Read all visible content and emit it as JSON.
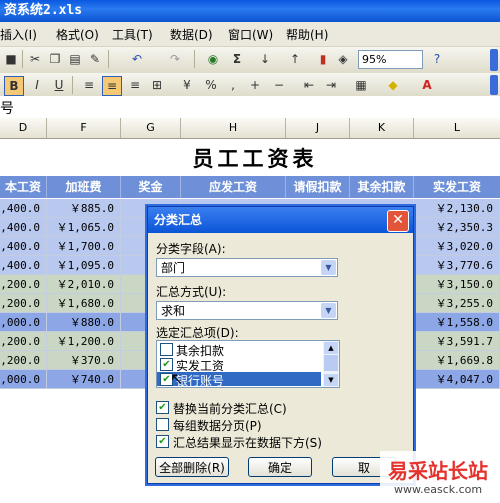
{
  "window": {
    "title": "资系统2.xls"
  },
  "menu": [
    "插入(I)",
    "格式(O)",
    "工具(T)",
    "数据(D)",
    "窗口(W)",
    "帮助(H)"
  ],
  "toolbar": {
    "zoom": "95%"
  },
  "formula_bar": {
    "text": "号"
  },
  "columns": [
    "D",
    "F",
    "G",
    "H",
    "J",
    "K",
    "L"
  ],
  "sheet": {
    "title": "员工工资表",
    "headers": [
      "本工资",
      "加班费",
      "奖金",
      "应发工资",
      "请假扣款",
      "其余扣款",
      "实发工资"
    ],
    "rows": [
      {
        "d": ",400.0",
        "f": "￥885.0",
        "g": "",
        "l": "￥2,130.0",
        "color": "#b8c8ee"
      },
      {
        "d": ",400.0",
        "f": "￥1,065.0",
        "g": "",
        "l": "￥2,350.3",
        "color": "#b8c8ee"
      },
      {
        "d": ",400.0",
        "f": "￥1,700.0",
        "g": "",
        "l": "￥3,020.0",
        "color": "#b8c8ee"
      },
      {
        "d": ",400.0",
        "f": "￥1,095.0",
        "g": "￥1,",
        "l": "￥3,770.6",
        "color": "#b8c8ee"
      },
      {
        "d": ",200.0",
        "f": "￥2,010.0",
        "g": "",
        "l": "￥3,150.0",
        "color": "#c9d7c4"
      },
      {
        "d": ",200.0",
        "f": "￥1,680.0",
        "g": "￥5",
        "l": "￥3,255.0",
        "color": "#c9d7c4"
      },
      {
        "d": ",000.0",
        "f": "￥880.0",
        "g": "￥1",
        "l": "￥1,558.0",
        "color": "#8ca6e6"
      },
      {
        "d": ",200.0",
        "f": "￥1,200.0",
        "g": "￥1",
        "l": "￥3,591.7",
        "color": "#c9d7c4"
      },
      {
        "d": ",200.0",
        "f": "￥370.0",
        "g": "￥1",
        "l": "￥1,669.8",
        "color": "#c9d7c4"
      },
      {
        "d": ",000.0",
        "f": "￥740.0",
        "g": "￥1,",
        "l": "￥4,047.0",
        "color": "#8ca6e6"
      }
    ]
  },
  "dialog": {
    "title": "分类汇总",
    "field_label": "分类字段(A):",
    "field_value": "部门",
    "method_label": "汇总方式(U):",
    "method_value": "求和",
    "items_label": "选定汇总项(D):",
    "items": [
      {
        "label": "其余扣款",
        "checked": false
      },
      {
        "label": "实发工资",
        "checked": true
      },
      {
        "label": "银行账号",
        "checked": true
      }
    ],
    "options": [
      {
        "label": "替换当前分类汇总(C)",
        "checked": true
      },
      {
        "label": "每组数据分页(P)",
        "checked": false
      },
      {
        "label": "汇总结果显示在数据下方(S)",
        "checked": true
      }
    ],
    "buttons": {
      "remove_all": "全部删除(R)",
      "ok": "确定",
      "cancel": "取"
    }
  },
  "watermark": {
    "text": "易采站长站",
    "url": "www.easck.com"
  }
}
